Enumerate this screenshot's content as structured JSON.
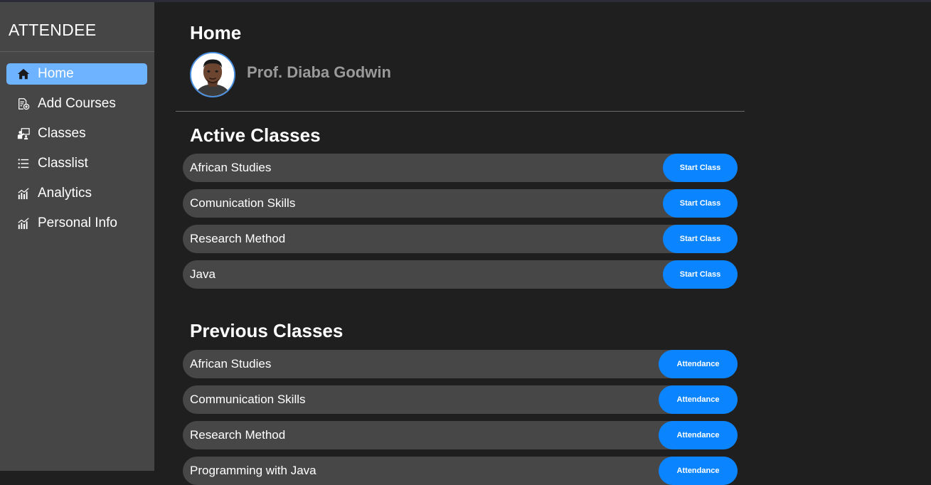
{
  "sidebar": {
    "brand": "ATTENDEE",
    "items": [
      {
        "label": "Home",
        "icon": "home-icon"
      },
      {
        "label": "Add Courses",
        "icon": "add-document-icon"
      },
      {
        "label": "Classes",
        "icon": "classroom-icon"
      },
      {
        "label": "Classlist",
        "icon": "list-icon"
      },
      {
        "label": "Analytics",
        "icon": "analytics-icon"
      },
      {
        "label": "Personal Info",
        "icon": "analytics-icon"
      }
    ],
    "active_index": 0
  },
  "header": {
    "title": "Home",
    "profile_name": "Prof. Diaba Godwin"
  },
  "active_classes": {
    "title": "Active Classes",
    "button_label": "Start Class",
    "items": [
      "African Studies",
      "Comunication Skills",
      "Research Method",
      "Java"
    ]
  },
  "previous_classes": {
    "title": "Previous Classes",
    "button_label": "Attendance",
    "items": [
      "African Studies",
      "Communication Skills",
      "Research Method",
      "Programming with Java"
    ]
  },
  "colors": {
    "accent": "#0a84ff",
    "active_nav": "#6db3ff",
    "sidebar_bg": "#464646",
    "main_bg": "#1f1f1f",
    "row_bg": "#474747"
  }
}
